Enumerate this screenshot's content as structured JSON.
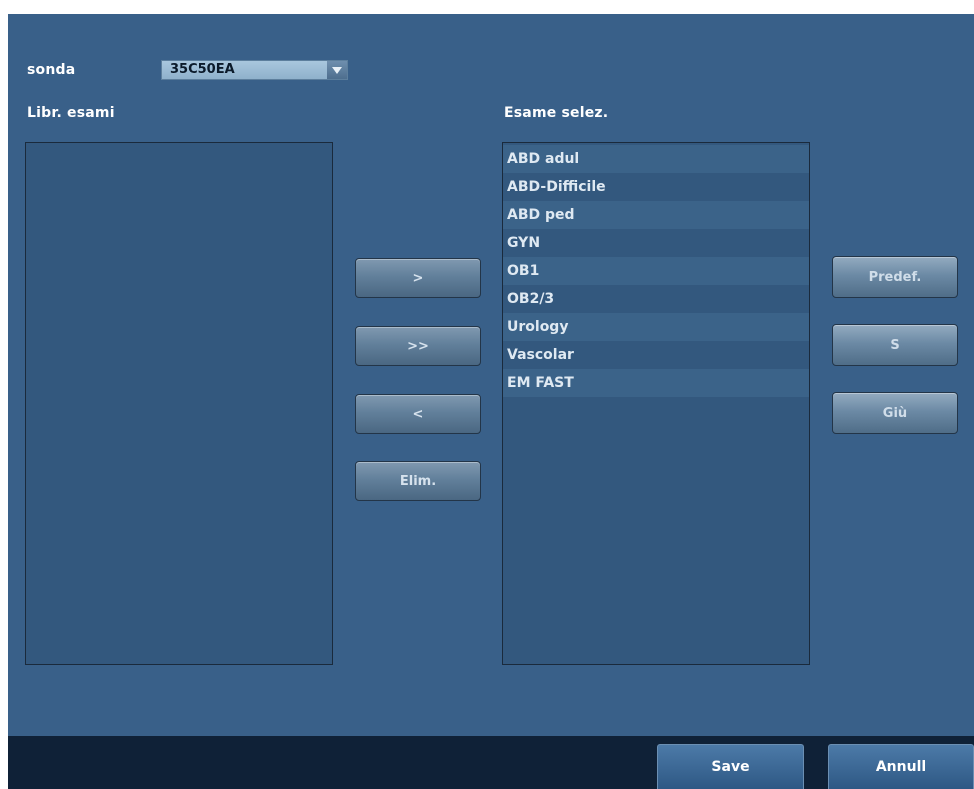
{
  "probe": {
    "label": "sonda",
    "value": "35C50EA"
  },
  "library": {
    "title": "Libr. esami",
    "items": []
  },
  "selected": {
    "title": "Esame selez.",
    "items": [
      "ABD adul",
      "ABD-Difficile",
      "ABD ped",
      "GYN",
      "OB1",
      "OB2/3",
      "Urology",
      "Vascolar",
      "EM FAST"
    ]
  },
  "transfer_buttons": {
    "add": ">",
    "add_all": ">>",
    "remove": "<",
    "delete": "Elim."
  },
  "order_buttons": {
    "default": "Predef.",
    "up": "S",
    "down": "Giù"
  },
  "footer": {
    "save": "Save",
    "cancel": "Annull"
  }
}
